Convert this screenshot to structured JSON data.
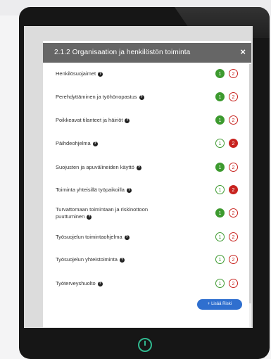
{
  "modal": {
    "title": "2.1.2 Organisaation ja henkilöstön toiminta",
    "close_label": "×",
    "add_button": "+ Lisää Riski"
  },
  "help_icon_glyph": "?",
  "items": [
    {
      "label": "Henkilösuojaimet",
      "left": {
        "value": "1",
        "style": "filled",
        "color": "#3d9a2f"
      },
      "right": {
        "value": "2",
        "style": "outline",
        "color": "#c8231f"
      }
    },
    {
      "label": "Perehdyttäminen ja työhönopastus",
      "left": {
        "value": "1",
        "style": "filled",
        "color": "#3d9a2f"
      },
      "right": {
        "value": "2",
        "style": "outline",
        "color": "#c8231f"
      }
    },
    {
      "label": "Poikkeavat tilanteet ja häiriöt",
      "left": {
        "value": "1",
        "style": "filled",
        "color": "#3d9a2f"
      },
      "right": {
        "value": "2",
        "style": "outline",
        "color": "#c8231f"
      }
    },
    {
      "label": "Päihdeohjelma",
      "left": {
        "value": "1",
        "style": "outline",
        "color": "#3d9a2f"
      },
      "right": {
        "value": "2",
        "style": "filled",
        "color": "#c8231f"
      }
    },
    {
      "label": "Suojusten ja apuvälineiden käyttö",
      "left": {
        "value": "1",
        "style": "filled",
        "color": "#3d9a2f"
      },
      "right": {
        "value": "2",
        "style": "outline",
        "color": "#c8231f"
      }
    },
    {
      "label": "Toiminta yhteisillä työpaikoilla",
      "left": {
        "value": "1",
        "style": "outline",
        "color": "#3d9a2f"
      },
      "right": {
        "value": "2",
        "style": "filled",
        "color": "#c8231f"
      }
    },
    {
      "label_line1": "Turvattomaan toimintaan ja riskinottoon",
      "label_line2": "puuttuminen",
      "left": {
        "value": "1",
        "style": "filled",
        "color": "#3d9a2f"
      },
      "right": {
        "value": "2",
        "style": "outline",
        "color": "#c8231f"
      }
    },
    {
      "label": "Työsuojelun toimintaohjelma",
      "left": {
        "value": "1",
        "style": "outline",
        "color": "#3d9a2f"
      },
      "right": {
        "value": "2",
        "style": "outline",
        "color": "#c8231f"
      }
    },
    {
      "label": "Työsuojelun yhteistoiminta",
      "left": {
        "value": "1",
        "style": "outline",
        "color": "#3d9a2f"
      },
      "right": {
        "value": "2",
        "style": "outline",
        "color": "#c8231f"
      }
    },
    {
      "label": "Työterveyshuolto",
      "left": {
        "value": "1",
        "style": "outline",
        "color": "#3d9a2f"
      },
      "right": {
        "value": "2",
        "style": "outline",
        "color": "#c8231f"
      }
    }
  ],
  "colors": {
    "header_bg": "#666666",
    "green": "#3d9a2f",
    "red": "#c8231f",
    "button_blue": "#2f6fcf",
    "power_teal": "#30b88f"
  }
}
